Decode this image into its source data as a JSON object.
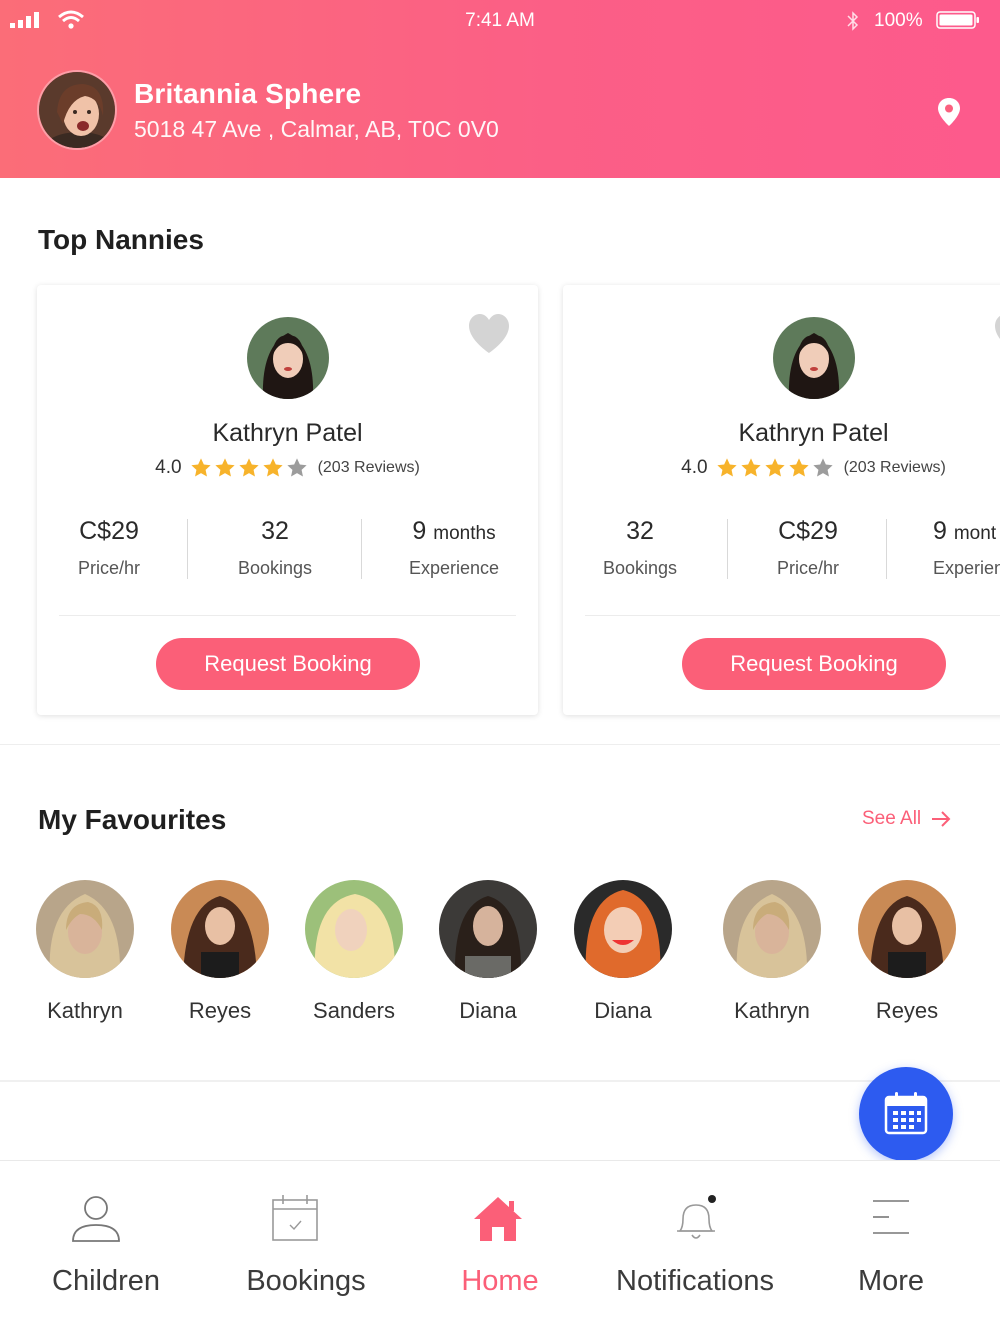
{
  "status_bar": {
    "time": "7:41 AM",
    "battery": "100%"
  },
  "header": {
    "user_name": "Britannia Sphere",
    "address": "5018 47 Ave , Calmar, AB, T0C 0V0"
  },
  "top_nannies": {
    "title": "Top Nannies",
    "cards": [
      {
        "name": "Kathryn Patel",
        "rating": "4.0",
        "stars_filled": 4,
        "stars_total": 5,
        "reviews": "(203 Reviews)",
        "stats": [
          {
            "value": "C$29",
            "unit": "",
            "label": "Price/hr"
          },
          {
            "value": "32",
            "unit": "",
            "label": "Bookings"
          },
          {
            "value": "9",
            "unit": "months",
            "label": "Experience"
          }
        ],
        "button": "Request Booking"
      },
      {
        "name": "Kathryn Patel",
        "rating": "4.0",
        "stars_filled": 4,
        "stars_total": 5,
        "reviews": "(203 Reviews)",
        "stats": [
          {
            "value": "32",
            "unit": "",
            "label": "Bookings"
          },
          {
            "value": "C$29",
            "unit": "",
            "label": "Price/hr"
          },
          {
            "value": "9",
            "unit": "mont",
            "label": "Experien"
          }
        ],
        "button": "Request Booking"
      }
    ]
  },
  "favourites": {
    "title": "My Favourites",
    "see_all": "See All",
    "items": [
      {
        "name": "Kathryn"
      },
      {
        "name": "Reyes"
      },
      {
        "name": "Sanders"
      },
      {
        "name": "Diana"
      },
      {
        "name": "Diana"
      },
      {
        "name": "Kathryn"
      },
      {
        "name": "Reyes"
      }
    ]
  },
  "bottom_nav": {
    "items": [
      {
        "label": "Children",
        "icon": "person-icon"
      },
      {
        "label": "Bookings",
        "icon": "calendar-icon"
      },
      {
        "label": "Home",
        "icon": "home-icon",
        "active": true
      },
      {
        "label": "Notifications",
        "icon": "bell-icon"
      },
      {
        "label": "More",
        "icon": "menu-icon"
      }
    ]
  },
  "colors": {
    "accent": "#fb5f78",
    "fab": "#2d5bf0",
    "star": "#f7b32b",
    "header_gradient_start": "#fb6d78",
    "header_gradient_end": "#fd5a8c"
  }
}
